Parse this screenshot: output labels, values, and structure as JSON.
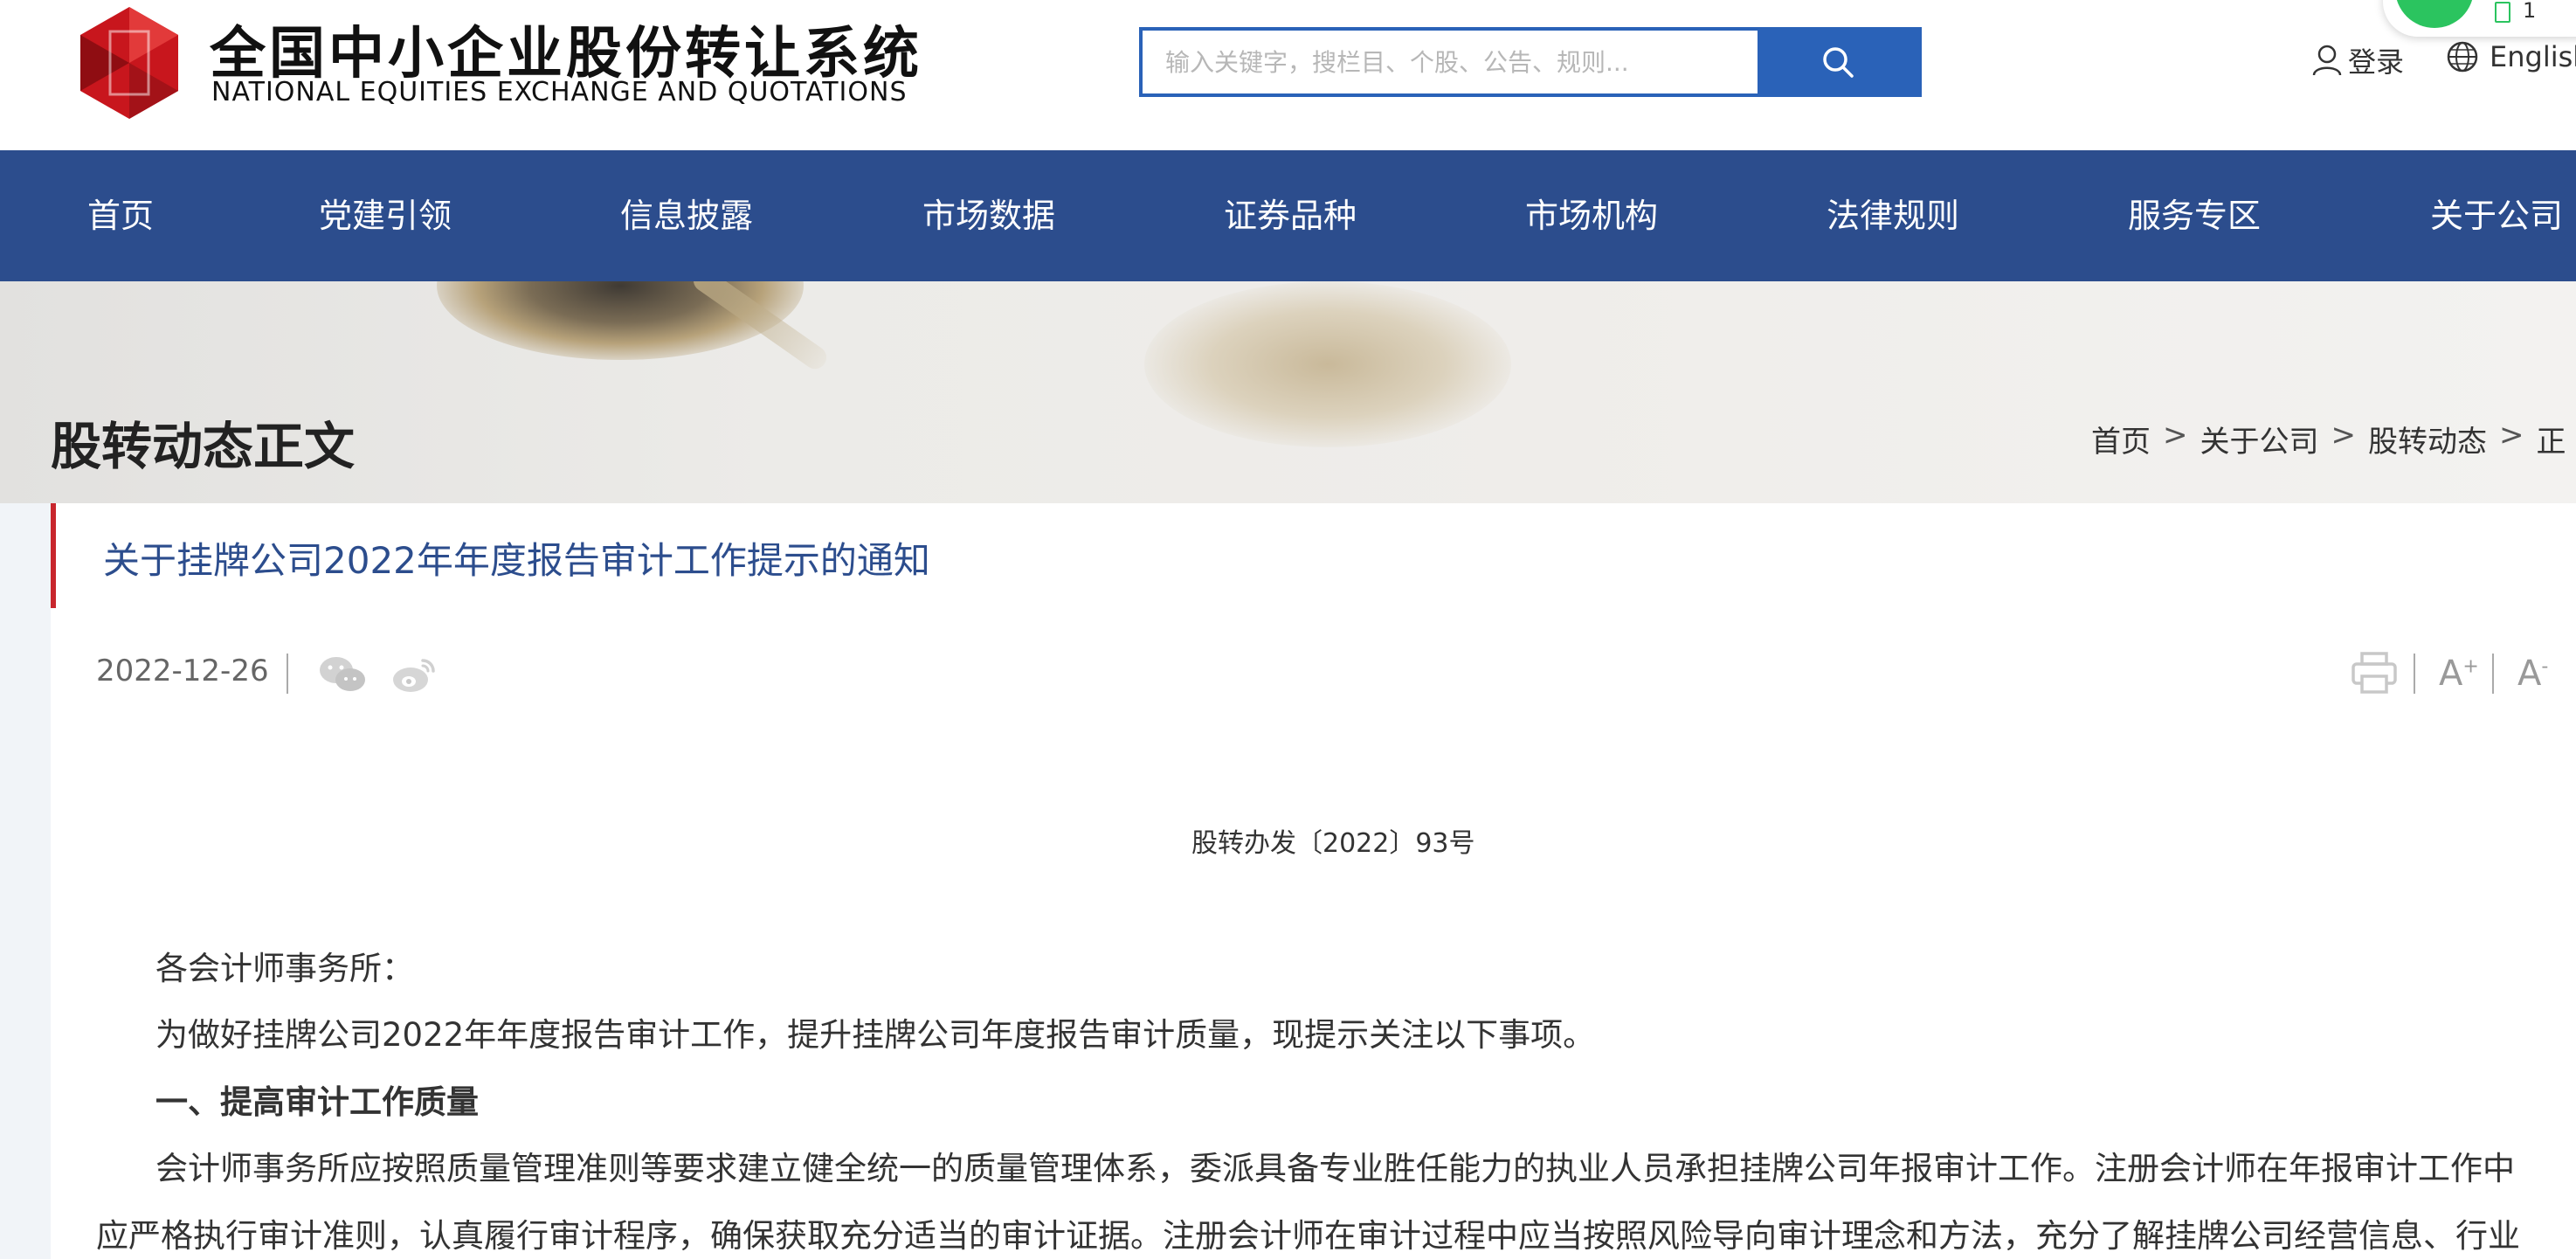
{
  "header": {
    "logo_cn": "全国中小企业股份转让系统",
    "logo_en": "NATIONAL EQUITIES EXCHANGE AND QUOTATIONS",
    "search_placeholder": "输入关键字，搜栏目、个股、公告、规则...",
    "search_value": "",
    "login_label": "登录",
    "english_label": "English",
    "float_badge": "1"
  },
  "nav": {
    "items": [
      "首页",
      "党建引领",
      "信息披露",
      "市场数据",
      "证券品种",
      "市场机构",
      "法律规则",
      "服务专区",
      "关于公司"
    ]
  },
  "banner": {
    "heading": "股转动态正文",
    "breadcrumb": [
      "首页",
      "关于公司",
      "股转动态",
      "正"
    ],
    "sep": ">"
  },
  "article": {
    "title": "关于挂牌公司2022年年度报告审计工作提示的通知",
    "date": "2022-12-26",
    "font_up": "A",
    "font_down": "A",
    "font_up_sup": "+",
    "font_down_sup": "-",
    "doc_number": "股转办发〔2022〕93号",
    "greeting": "各会计师事务所：",
    "intro": "为做好挂牌公司2022年年度报告审计工作，提升挂牌公司年度报告审计质量，现提示关注以下事项。",
    "section1_heading": "一、提高审计工作质量",
    "section1_line1": "会计师事务所应按照质量管理准则等要求建立健全统一的质量管理体系，委派具备专业胜任能力的执业人员承担挂牌公司年报审计工作。注册会计师在年报审计工作中",
    "section1_line2": "应严格执行审计准则，认真履行审计程序，确保获取充分适当的审计证据。注册会计师在审计过程中应当按照风险导向审计理念和方法，充分了解挂牌公司经营信息、行业"
  },
  "colors": {
    "nav_bg": "#2c4d8d",
    "search_blue": "#2a62b8",
    "title_accent": "#c8262d",
    "title_text": "#2c4d8d"
  }
}
